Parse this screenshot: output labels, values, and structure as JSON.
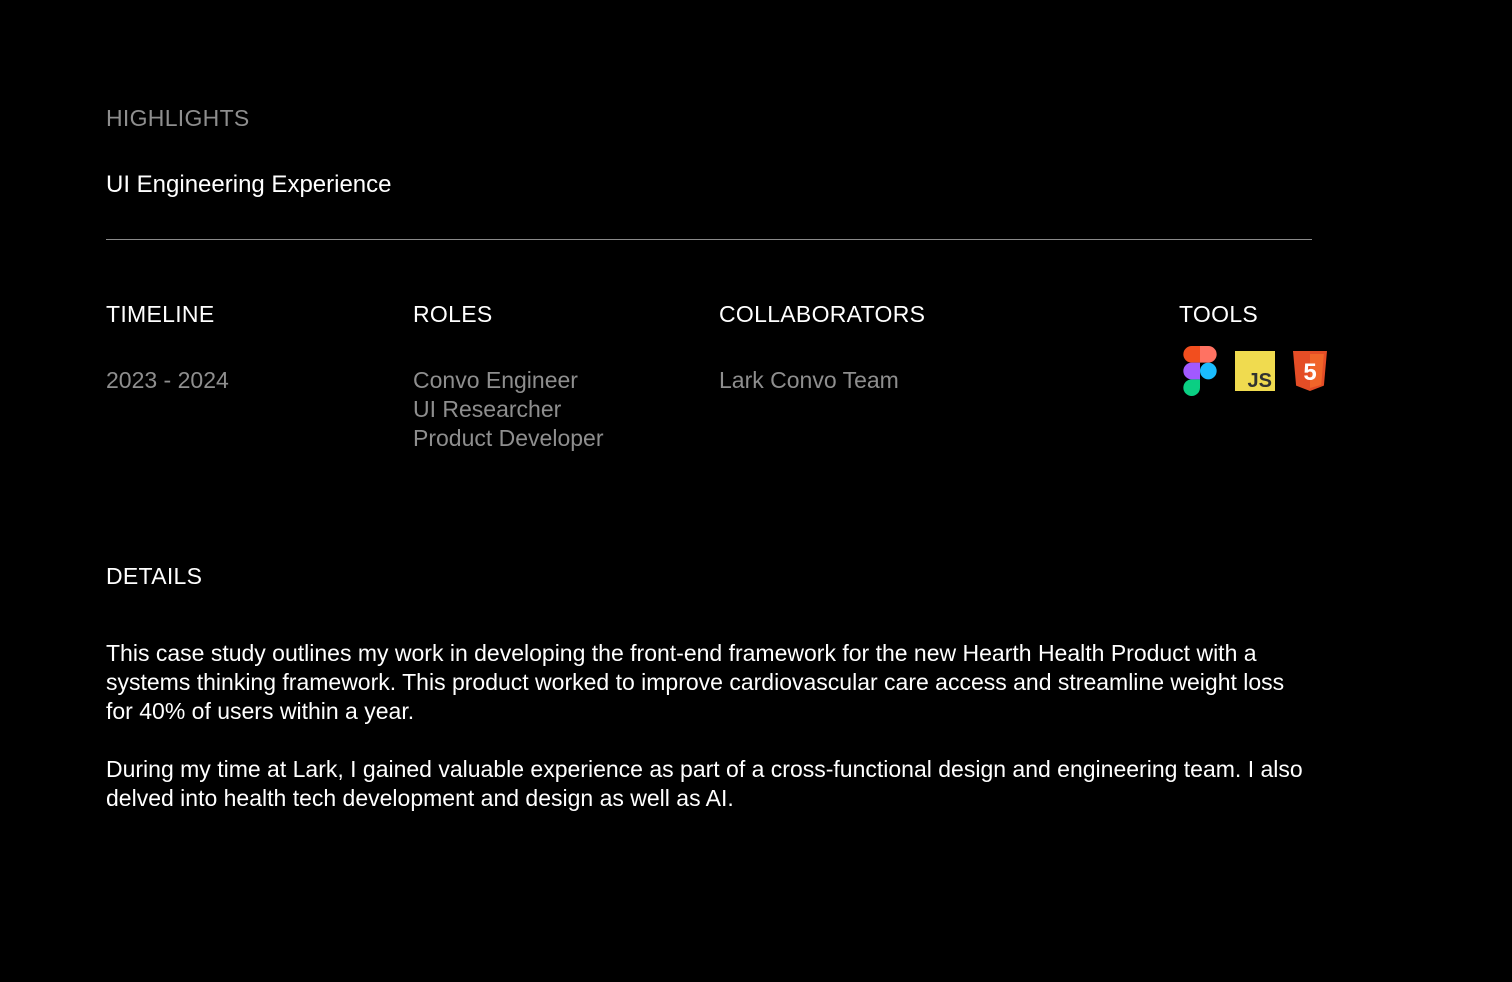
{
  "highlights": {
    "eyebrow": "HIGHLIGHTS",
    "title": "UI Engineering Experience"
  },
  "meta": {
    "timeline": {
      "label": "TIMELINE",
      "value": "2023 - 2024"
    },
    "roles": {
      "label": "ROLES",
      "items": [
        "Convo Engineer",
        "UI Researcher",
        "Product Developer"
      ]
    },
    "collaborators": {
      "label": "COLLABORATORS",
      "value": "Lark Convo Team"
    },
    "tools": {
      "label": "TOOLS",
      "icons": [
        "figma-icon",
        "javascript-icon",
        "html5-icon"
      ],
      "js_text": "JS",
      "html_text": "5"
    }
  },
  "details": {
    "label": "DETAILS",
    "paragraphs": [
      "This case study outlines my work in developing the front-end framework for the new Hearth Health Product with a systems thinking framework. This product worked to improve cardiovascular care access and streamline weight loss for 40% of users within a year.",
      "During my time at Lark, I gained valuable experience as part of a cross-functional design and engineering team. I also delved into health tech development and design as well as AI."
    ]
  },
  "colors": {
    "background": "#000000",
    "text_primary": "#ffffff",
    "text_muted": "#8e8e8e",
    "divider": "#8a8a8a",
    "js_yellow": "#f0db4f",
    "html_orange": "#e44d26"
  }
}
